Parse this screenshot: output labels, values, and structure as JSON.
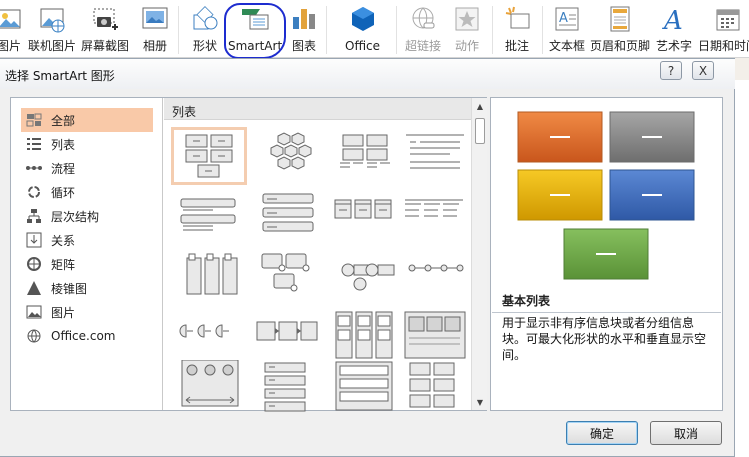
{
  "ribbon": {
    "buttons": [
      {
        "label": "图片",
        "icon": "picture-icon"
      },
      {
        "label": "联机图片",
        "icon": "online-picture-icon"
      },
      {
        "label": "屏幕截图",
        "icon": "screenshot-icon"
      },
      {
        "label": "相册",
        "icon": "photo-album-icon"
      },
      {
        "label": "形状",
        "icon": "shapes-icon"
      },
      {
        "label": "SmartArt",
        "icon": "smartart-icon"
      },
      {
        "label": "图表",
        "icon": "chart-icon"
      },
      {
        "label": "Office",
        "icon": "office-store-icon"
      },
      {
        "label": "超链接",
        "icon": "hyperlink-icon"
      },
      {
        "label": "动作",
        "icon": "action-icon"
      },
      {
        "label": "批注",
        "icon": "comment-icon"
      },
      {
        "label": "文本框",
        "icon": "textbox-icon"
      },
      {
        "label": "页眉和页脚",
        "icon": "header-footer-icon"
      },
      {
        "label": "艺术字",
        "icon": "wordart-icon"
      },
      {
        "label": "日期和时间",
        "icon": "datetime-icon"
      }
    ]
  },
  "dialog": {
    "title": "选择 SmartArt 图形",
    "help_label": "?",
    "close_label": "X",
    "ok_label": "确定",
    "cancel_label": "取消"
  },
  "categories": [
    {
      "label": "全部",
      "icon": "all-icon",
      "selected": true
    },
    {
      "label": "列表",
      "icon": "list-icon"
    },
    {
      "label": "流程",
      "icon": "process-icon"
    },
    {
      "label": "循环",
      "icon": "cycle-icon"
    },
    {
      "label": "层次结构",
      "icon": "hierarchy-icon"
    },
    {
      "label": "关系",
      "icon": "relationship-icon"
    },
    {
      "label": "矩阵",
      "icon": "matrix-icon"
    },
    {
      "label": "棱锥图",
      "icon": "pyramid-icon"
    },
    {
      "label": "图片",
      "icon": "picture-icon"
    },
    {
      "label": "Office.com",
      "icon": "globe-icon"
    }
  ],
  "gallery": {
    "header": "列表",
    "selected_index": 0
  },
  "preview": {
    "title": "基本列表",
    "description": "用于显示非有序信息块或者分组信息块。可最大化形状的水平和垂直显示空间。",
    "colors": [
      "#e36c2a",
      "#8c8c8c",
      "#e9b200",
      "#3d6fbf",
      "#6aa646"
    ]
  }
}
